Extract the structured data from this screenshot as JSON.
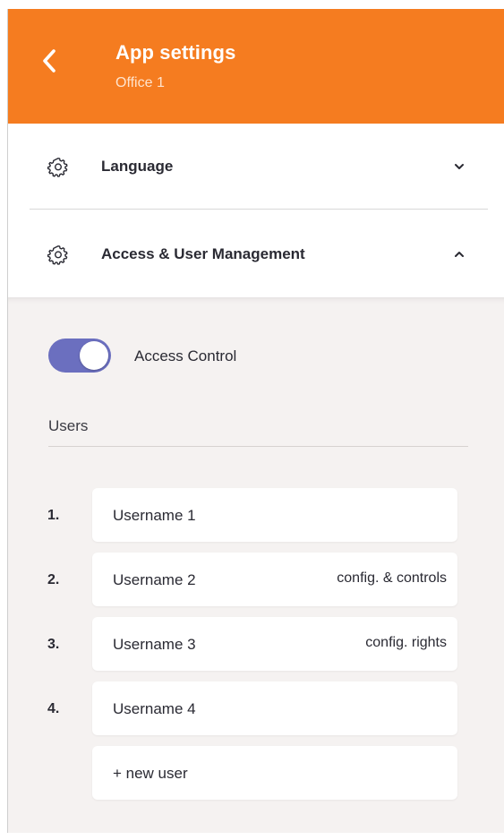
{
  "colors": {
    "accent": "#f57c20",
    "toggle": "#6b6fbf",
    "panel": "#f5f2f1"
  },
  "header": {
    "title": "App settings",
    "subtitle": "Office 1",
    "back_icon": "chevron-left-icon"
  },
  "sections": [
    {
      "label": "Language",
      "icon": "gear-icon",
      "expanded": false
    },
    {
      "label": "Access & User Management",
      "icon": "gear-icon",
      "expanded": true
    }
  ],
  "access": {
    "toggle_label": "Access Control",
    "enabled": true,
    "users_heading": "Users",
    "users": [
      {
        "num": "1.",
        "name": "Username 1",
        "role": ""
      },
      {
        "num": "2.",
        "name": "Username 2",
        "role": "config. & controls"
      },
      {
        "num": "3.",
        "name": "Username 3",
        "role": "config. rights"
      },
      {
        "num": "4.",
        "name": "Username 4",
        "role": ""
      }
    ],
    "new_user_label": "+ new user"
  }
}
